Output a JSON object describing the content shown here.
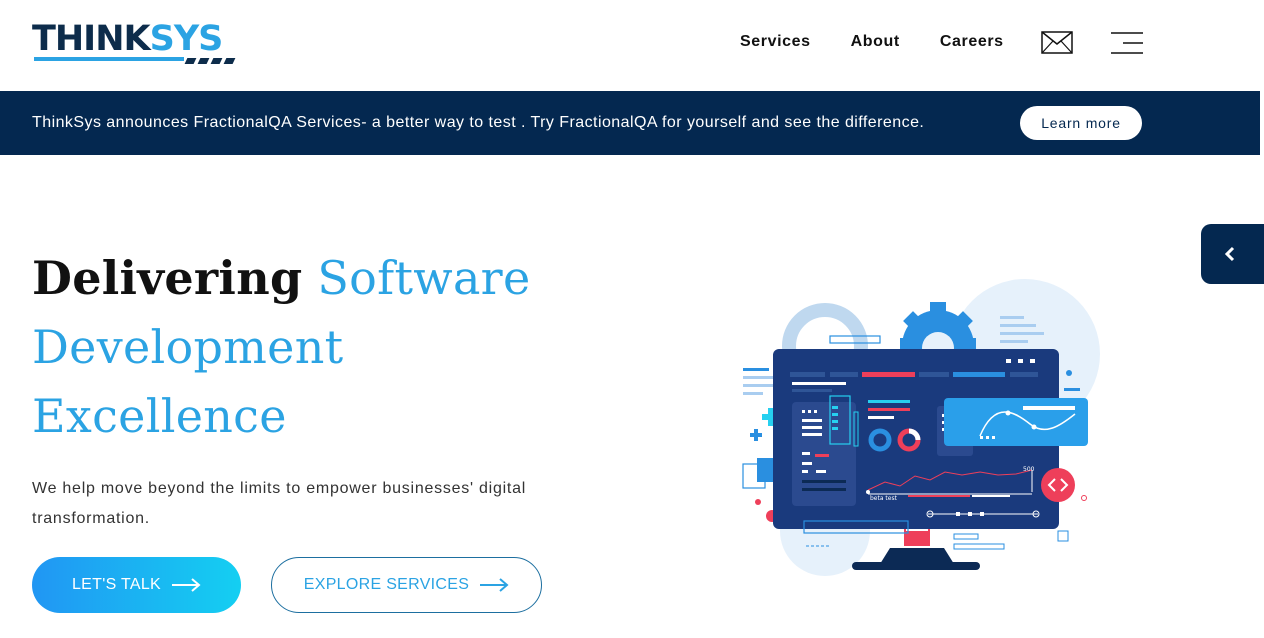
{
  "header": {
    "logo": {
      "part1": "THINK",
      "part2": "SYS"
    },
    "nav": [
      {
        "label": "Services"
      },
      {
        "label": "About"
      },
      {
        "label": "Careers"
      }
    ],
    "icons": [
      "envelope-icon",
      "hamburger-menu-icon"
    ]
  },
  "banner": {
    "text": "ThinkSys announces FractionalQA Services- a better way to test . Try FractionalQA for yourself and see the difference.",
    "button_label": "Learn more"
  },
  "hero": {
    "title_strong": "Delivering",
    "title_rest1": "Software",
    "title_line2": "Development",
    "title_line3": "Excellence",
    "subtitle": "We help move beyond the limits to empower businesses' digital transformation.",
    "cta_primary": "LET'S TALK",
    "cta_secondary": "EXPLORE SERVICES"
  },
  "illustration": {
    "chart_peak_label": "500",
    "chart_caption": "beta test"
  },
  "colors": {
    "navy": "#042850",
    "brand_blue": "#2ba3e3",
    "accent_red": "#ee3f5a"
  }
}
